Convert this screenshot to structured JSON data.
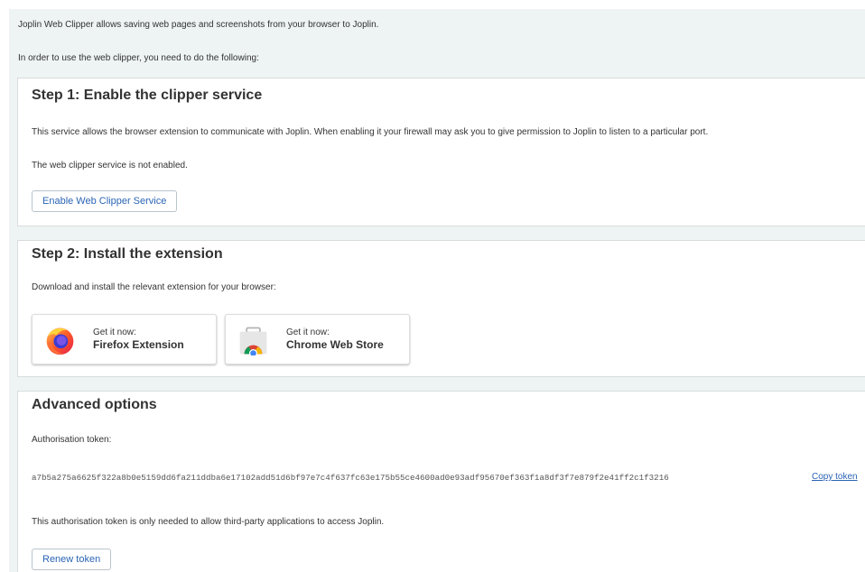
{
  "intro": {
    "line1": "Joplin Web Clipper allows saving web pages and screenshots from your browser to Joplin.",
    "line2": "In order to use the web clipper, you need to do the following:"
  },
  "step1": {
    "title": "Step 1: Enable the clipper service",
    "description": "This service allows the browser extension to communicate with Joplin. When enabling it your firewall may ask you to give permission to Joplin to listen to a particular port.",
    "status": "The web clipper service is not enabled.",
    "button_label": "Enable Web Clipper Service"
  },
  "step2": {
    "title": "Step 2: Install the extension",
    "description": "Download and install the relevant extension for your browser:",
    "extensions": [
      {
        "kicker": "Get it now:",
        "name": "Firefox Extension",
        "icon": "firefox-icon"
      },
      {
        "kicker": "Get it now:",
        "name": "Chrome Web Store",
        "icon": "chrome-web-store-icon"
      }
    ]
  },
  "advanced": {
    "title": "Advanced options",
    "token_label": "Authorisation token:",
    "token": "a7b5a275a6625f322a8b0e5159dd6fa211ddba6e17102add51d6bf97e7c4f637fc63e175b55ce4600ad0e93adf95670ef363f1a8df3f7e879f2e41ff2c1f3216",
    "copy_label": "Copy token",
    "note": "This authorisation token is only needed to allow third-party applications to access Joplin.",
    "renew_label": "Renew token"
  },
  "colors": {
    "background": "#eef3f3",
    "card": "#ffffff",
    "link": "#2b65b5",
    "text": "#333333"
  }
}
